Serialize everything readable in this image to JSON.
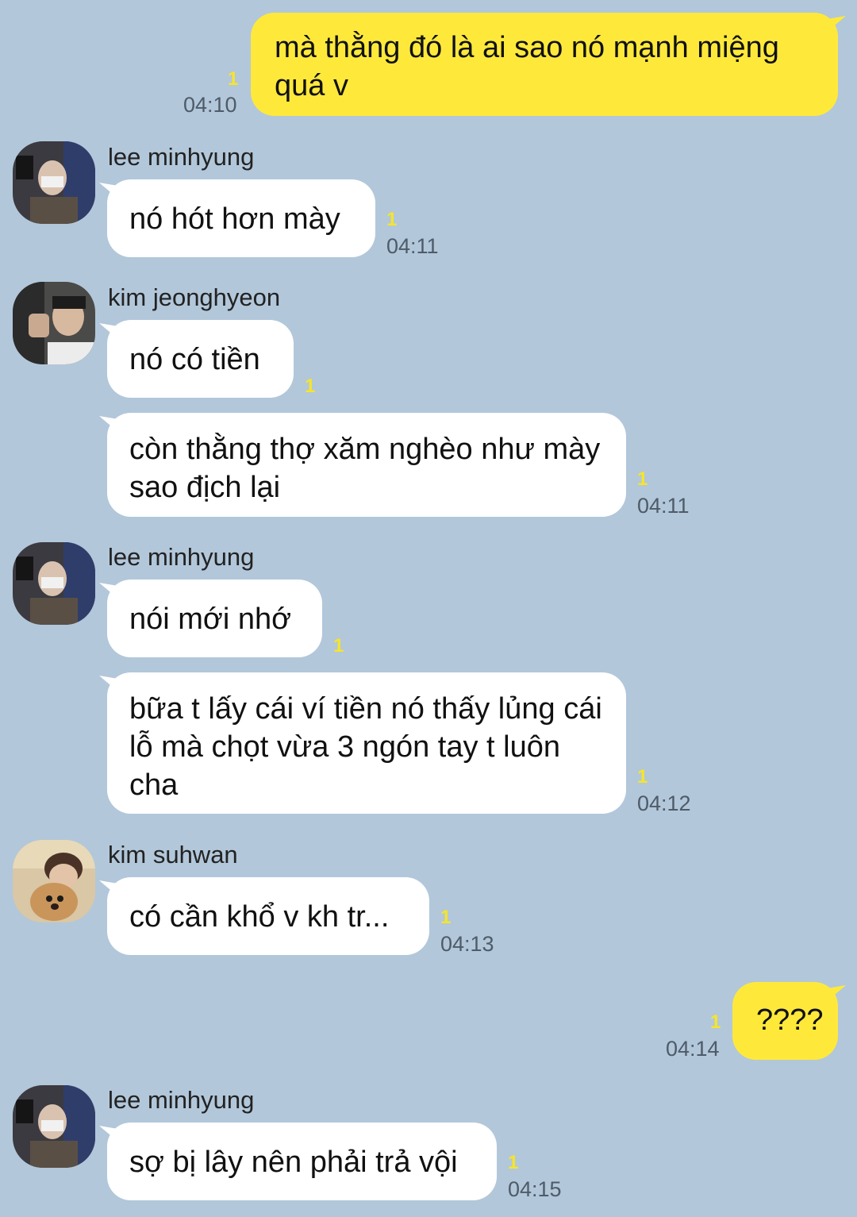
{
  "messages": [
    {
      "sender": "",
      "text": "mà thằng đó là ai sao nó mạnh miệng quá v",
      "unread": "1",
      "time": "04:10"
    },
    {
      "sender": "lee minhyung",
      "text": "nó hót hơn mày",
      "unread": "1",
      "time": "04:11"
    },
    {
      "sender": "kim jeonghyeon",
      "text": "nó có tiền",
      "unread": "1",
      "time": ""
    },
    {
      "sender": "",
      "text": "còn thằng thợ xăm nghèo như mày sao địch lại",
      "unread": "1",
      "time": "04:11"
    },
    {
      "sender": "lee minhyung",
      "text": "nói mới nhớ",
      "unread": "1",
      "time": ""
    },
    {
      "sender": "",
      "text": "bữa t lấy cái ví tiền nó thấy lủng cái lỗ mà chọt vừa 3 ngón tay t luôn cha",
      "unread": "1",
      "time": "04:12"
    },
    {
      "sender": "kim suhwan",
      "text": "có cần khổ v kh tr...",
      "unread": "1",
      "time": "04:13"
    },
    {
      "sender": "",
      "text": "????",
      "unread": "1",
      "time": "04:14"
    },
    {
      "sender": "lee minhyung",
      "text": "sợ bị lây nên phải trả vội",
      "unread": "1",
      "time": "04:15"
    }
  ],
  "colors": {
    "background": "#b2c7da",
    "outgoing_bubble": "#fee93b",
    "incoming_bubble": "#ffffff",
    "unread_count": "#f6e52a"
  }
}
